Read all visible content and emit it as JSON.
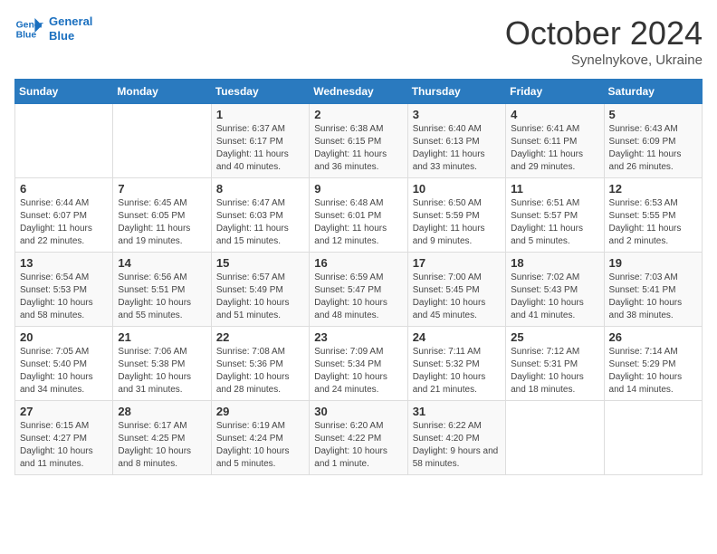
{
  "header": {
    "logo_line1": "General",
    "logo_line2": "Blue",
    "month": "October 2024",
    "location": "Synelnykove, Ukraine"
  },
  "days_of_week": [
    "Sunday",
    "Monday",
    "Tuesday",
    "Wednesday",
    "Thursday",
    "Friday",
    "Saturday"
  ],
  "weeks": [
    [
      {
        "day": "",
        "info": ""
      },
      {
        "day": "",
        "info": ""
      },
      {
        "day": "1",
        "info": "Sunrise: 6:37 AM\nSunset: 6:17 PM\nDaylight: 11 hours and 40 minutes."
      },
      {
        "day": "2",
        "info": "Sunrise: 6:38 AM\nSunset: 6:15 PM\nDaylight: 11 hours and 36 minutes."
      },
      {
        "day": "3",
        "info": "Sunrise: 6:40 AM\nSunset: 6:13 PM\nDaylight: 11 hours and 33 minutes."
      },
      {
        "day": "4",
        "info": "Sunrise: 6:41 AM\nSunset: 6:11 PM\nDaylight: 11 hours and 29 minutes."
      },
      {
        "day": "5",
        "info": "Sunrise: 6:43 AM\nSunset: 6:09 PM\nDaylight: 11 hours and 26 minutes."
      }
    ],
    [
      {
        "day": "6",
        "info": "Sunrise: 6:44 AM\nSunset: 6:07 PM\nDaylight: 11 hours and 22 minutes."
      },
      {
        "day": "7",
        "info": "Sunrise: 6:45 AM\nSunset: 6:05 PM\nDaylight: 11 hours and 19 minutes."
      },
      {
        "day": "8",
        "info": "Sunrise: 6:47 AM\nSunset: 6:03 PM\nDaylight: 11 hours and 15 minutes."
      },
      {
        "day": "9",
        "info": "Sunrise: 6:48 AM\nSunset: 6:01 PM\nDaylight: 11 hours and 12 minutes."
      },
      {
        "day": "10",
        "info": "Sunrise: 6:50 AM\nSunset: 5:59 PM\nDaylight: 11 hours and 9 minutes."
      },
      {
        "day": "11",
        "info": "Sunrise: 6:51 AM\nSunset: 5:57 PM\nDaylight: 11 hours and 5 minutes."
      },
      {
        "day": "12",
        "info": "Sunrise: 6:53 AM\nSunset: 5:55 PM\nDaylight: 11 hours and 2 minutes."
      }
    ],
    [
      {
        "day": "13",
        "info": "Sunrise: 6:54 AM\nSunset: 5:53 PM\nDaylight: 10 hours and 58 minutes."
      },
      {
        "day": "14",
        "info": "Sunrise: 6:56 AM\nSunset: 5:51 PM\nDaylight: 10 hours and 55 minutes."
      },
      {
        "day": "15",
        "info": "Sunrise: 6:57 AM\nSunset: 5:49 PM\nDaylight: 10 hours and 51 minutes."
      },
      {
        "day": "16",
        "info": "Sunrise: 6:59 AM\nSunset: 5:47 PM\nDaylight: 10 hours and 48 minutes."
      },
      {
        "day": "17",
        "info": "Sunrise: 7:00 AM\nSunset: 5:45 PM\nDaylight: 10 hours and 45 minutes."
      },
      {
        "day": "18",
        "info": "Sunrise: 7:02 AM\nSunset: 5:43 PM\nDaylight: 10 hours and 41 minutes."
      },
      {
        "day": "19",
        "info": "Sunrise: 7:03 AM\nSunset: 5:41 PM\nDaylight: 10 hours and 38 minutes."
      }
    ],
    [
      {
        "day": "20",
        "info": "Sunrise: 7:05 AM\nSunset: 5:40 PM\nDaylight: 10 hours and 34 minutes."
      },
      {
        "day": "21",
        "info": "Sunrise: 7:06 AM\nSunset: 5:38 PM\nDaylight: 10 hours and 31 minutes."
      },
      {
        "day": "22",
        "info": "Sunrise: 7:08 AM\nSunset: 5:36 PM\nDaylight: 10 hours and 28 minutes."
      },
      {
        "day": "23",
        "info": "Sunrise: 7:09 AM\nSunset: 5:34 PM\nDaylight: 10 hours and 24 minutes."
      },
      {
        "day": "24",
        "info": "Sunrise: 7:11 AM\nSunset: 5:32 PM\nDaylight: 10 hours and 21 minutes."
      },
      {
        "day": "25",
        "info": "Sunrise: 7:12 AM\nSunset: 5:31 PM\nDaylight: 10 hours and 18 minutes."
      },
      {
        "day": "26",
        "info": "Sunrise: 7:14 AM\nSunset: 5:29 PM\nDaylight: 10 hours and 14 minutes."
      }
    ],
    [
      {
        "day": "27",
        "info": "Sunrise: 6:15 AM\nSunset: 4:27 PM\nDaylight: 10 hours and 11 minutes."
      },
      {
        "day": "28",
        "info": "Sunrise: 6:17 AM\nSunset: 4:25 PM\nDaylight: 10 hours and 8 minutes."
      },
      {
        "day": "29",
        "info": "Sunrise: 6:19 AM\nSunset: 4:24 PM\nDaylight: 10 hours and 5 minutes."
      },
      {
        "day": "30",
        "info": "Sunrise: 6:20 AM\nSunset: 4:22 PM\nDaylight: 10 hours and 1 minute."
      },
      {
        "day": "31",
        "info": "Sunrise: 6:22 AM\nSunset: 4:20 PM\nDaylight: 9 hours and 58 minutes."
      },
      {
        "day": "",
        "info": ""
      },
      {
        "day": "",
        "info": ""
      }
    ]
  ]
}
